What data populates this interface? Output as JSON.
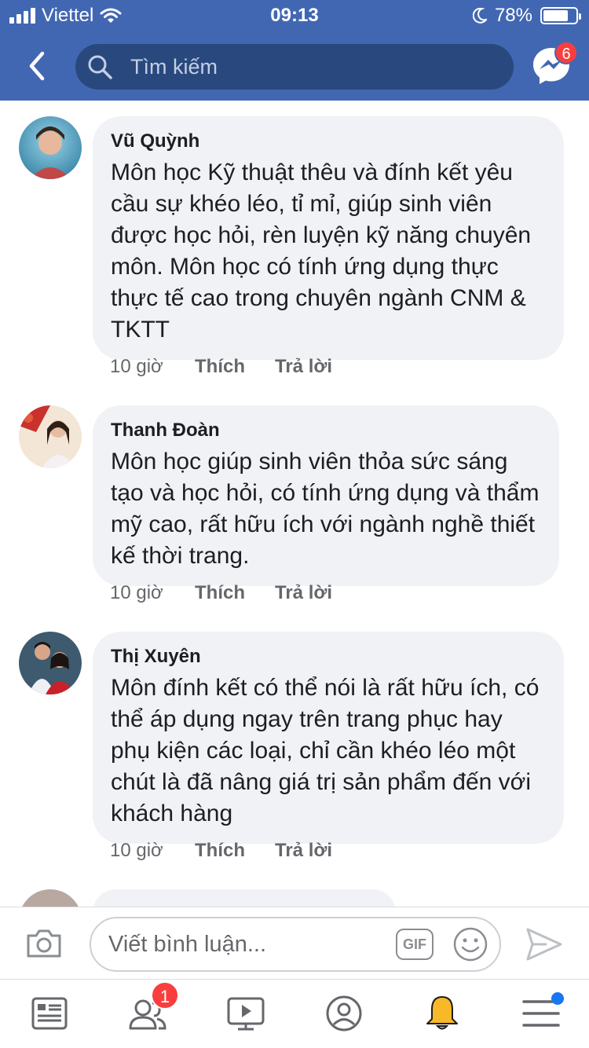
{
  "status_bar": {
    "carrier": "Viettel",
    "time": "09:13",
    "battery": "78%",
    "battery_level": 0.78
  },
  "nav": {
    "search_placeholder": "Tìm kiếm",
    "messenger_badge": "6"
  },
  "comments": [
    {
      "author": "Vũ Quỳnh",
      "text": "Môn học Kỹ thuật thêu và đính kết yêu cầu sự khéo léo, tỉ mỉ, giúp sinh viên được học hỏi, rèn luyện kỹ năng chuyên môn. Môn học có tính ứng dụng thực thực tế cao trong chuyên ngành CNM & TKTT",
      "time": "10 giờ",
      "like": "Thích",
      "reply": "Trả lời"
    },
    {
      "author": "Thanh Đoàn",
      "text": "Môn học giúp sinh viên thỏa sức sáng tạo và học hỏi, có tính ứng dụng và thẩm mỹ cao, rất hữu ích với ngành nghề thiết kế thời trang.",
      "time": "10 giờ",
      "like": "Thích",
      "reply": "Trả lời"
    },
    {
      "author": "Thị Xuyên",
      "text": "Môn đính kết có thể nói là rất hữu ích, có thể áp dụng ngay trên trang phục hay phụ kiện các loại, chỉ cần khéo léo một chút là đã nâng giá trị sản phẩm đến với khách hàng",
      "time": "10 giờ",
      "like": "Thích",
      "reply": "Trả lời"
    }
  ],
  "composer": {
    "placeholder": "Viết bình luận...",
    "gif_label": "GIF"
  },
  "tabbar": {
    "friends_badge": "1"
  },
  "colors": {
    "brand": "#4267b2",
    "search_bg": "#29487d",
    "bubble": "#f0f2f5",
    "badge": "#fa3e3e",
    "bell": "#f7b928",
    "dot": "#1877f2"
  }
}
